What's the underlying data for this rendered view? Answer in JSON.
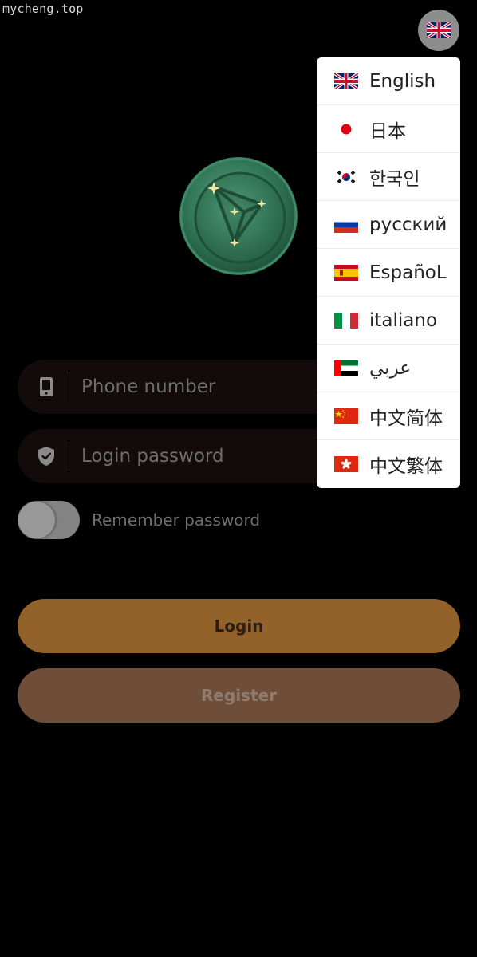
{
  "watermark": "mycheng.top",
  "header": {
    "language_toggle_icon": "uk-flag-icon"
  },
  "logo": {
    "icon": "tron-coin-logo"
  },
  "form": {
    "phone": {
      "placeholder": "Phone number",
      "value": "",
      "icon": "phone-icon"
    },
    "password": {
      "placeholder": "Login password",
      "value": "",
      "icon": "shield-icon"
    },
    "remember": {
      "label": "Remember password",
      "checked": false
    }
  },
  "buttons": {
    "login_label": "Login",
    "register_label": "Register"
  },
  "language_menu": {
    "items": [
      {
        "label": "English",
        "flag": "uk-flag-icon"
      },
      {
        "label": "日本",
        "flag": "japan-flag-icon"
      },
      {
        "label": "한국인",
        "flag": "korea-flag-icon"
      },
      {
        "label": "русский",
        "flag": "russia-flag-icon"
      },
      {
        "label": "EspañoL",
        "flag": "spain-flag-icon"
      },
      {
        "label": "italiano",
        "flag": "italy-flag-icon"
      },
      {
        "label": "عربي",
        "flag": "uae-flag-icon"
      },
      {
        "label": "中文简体",
        "flag": "china-flag-icon"
      },
      {
        "label": "中文繁体",
        "flag": "hongkong-flag-icon"
      }
    ]
  },
  "colors": {
    "background": "#000000",
    "login_button": "#93622a",
    "register_button": "#6e4d39",
    "input_background": "#120b0a"
  }
}
